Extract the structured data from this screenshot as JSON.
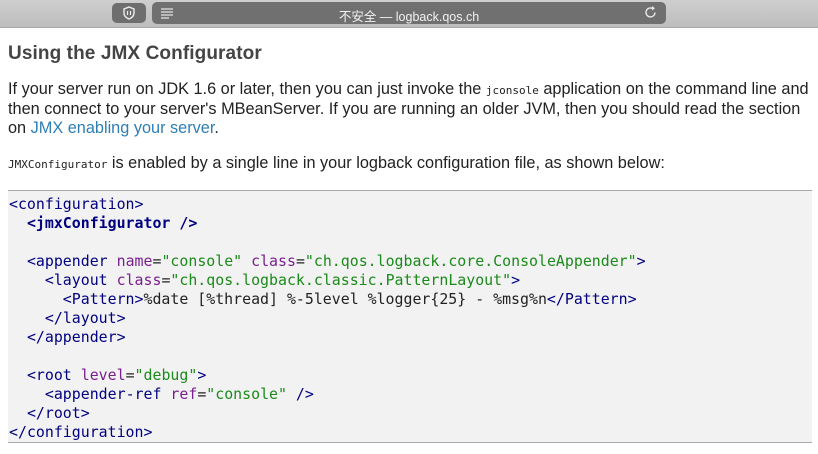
{
  "browser": {
    "address_text": "不安全 — logback.qos.ch"
  },
  "article": {
    "heading": "Using the JMX Configurator",
    "para1": {
      "part1": "If your server run on JDK 1.6 or later, then you can just invoke the ",
      "code": "jconsole",
      "part2": " application on the command line and then connect to your server's MBeanServer. If you are running an older JVM, then you should read the section on ",
      "link": "JMX enabling your server",
      "part3": "."
    },
    "para2": {
      "code": "JMXConfigurator",
      "text": " is enabled by a single line in your logback configuration file, as shown below:"
    }
  },
  "code": {
    "configuration": "configuration",
    "jmx": "jmxConfigurator",
    "appender": "appender",
    "name_attr": "name",
    "name_val": "\"console\"",
    "class_attr": "class",
    "appender_class_val": "\"ch.qos.logback.core.ConsoleAppender\"",
    "layout": "layout",
    "layout_class_val": "\"ch.qos.logback.classic.PatternLayout\"",
    "pattern": "Pattern",
    "pattern_text": "%date [%thread] %-5level %logger{25} - %msg%n",
    "root": "root",
    "level_attr": "level",
    "level_val": "\"debug\"",
    "appender_ref": "appender-ref",
    "ref_attr": "ref",
    "ref_val": "\"console\""
  }
}
